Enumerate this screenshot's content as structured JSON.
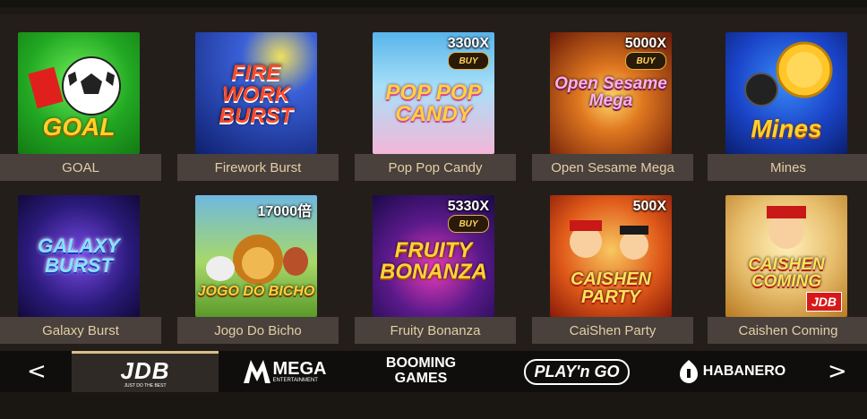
{
  "games": [
    {
      "title": "GOAL",
      "art_text": "GOAL",
      "bg": "#2fbf2f"
    },
    {
      "title": "Firework Burst",
      "art_text": "FIRE WORK BURST",
      "bg": "#1d3fb5"
    },
    {
      "title": "Pop Pop Candy",
      "art_text": "POP POP CANDY",
      "badge": "3300X",
      "buy": "BUY",
      "bg": "#5fb4e8"
    },
    {
      "title": "Open Sesame Mega",
      "art_text": "Open Sesame Mega",
      "badge": "5000X",
      "buy": "BUY",
      "bg": "#a83a14"
    },
    {
      "title": "Mines",
      "art_text": "Mines",
      "bg": "#1a44c8"
    },
    {
      "title": "Galaxy Burst",
      "art_text": "GALAXY BURST",
      "bg": "#2a1a7a"
    },
    {
      "title": "Jogo Do Bicho",
      "art_text": "JOGO DO BICHO",
      "badge": "17000倍",
      "bg": "#6fb8e0"
    },
    {
      "title": "Fruity Bonanza",
      "art_text": "FRUITY BONANZA",
      "badge": "5330X",
      "buy": "BUY",
      "bg": "#5a1a8a"
    },
    {
      "title": "CaiShen Party",
      "art_text": "CAISHEN PARTY",
      "badge": "500X",
      "bg": "#d84818"
    },
    {
      "title": "Caishen Coming",
      "art_text": "CAISHEN COMING",
      "corner": "JDB",
      "bg": "#e8c070"
    }
  ],
  "providers": {
    "prev": "<",
    "next": ">",
    "items": [
      {
        "name": "JDB",
        "sub": "JUST DO THE BEST"
      },
      {
        "name": "MEGA",
        "sub": "ENTERTAINMENT"
      },
      {
        "name": "BOOMING",
        "sub": "GAMES"
      },
      {
        "name": "PLAY'n GO"
      },
      {
        "name": "HABANERO"
      }
    ]
  },
  "colors": {
    "label_bg": "#4a403c",
    "label_text": "#e2cfa6",
    "active_provider_border": "#d8c089"
  }
}
